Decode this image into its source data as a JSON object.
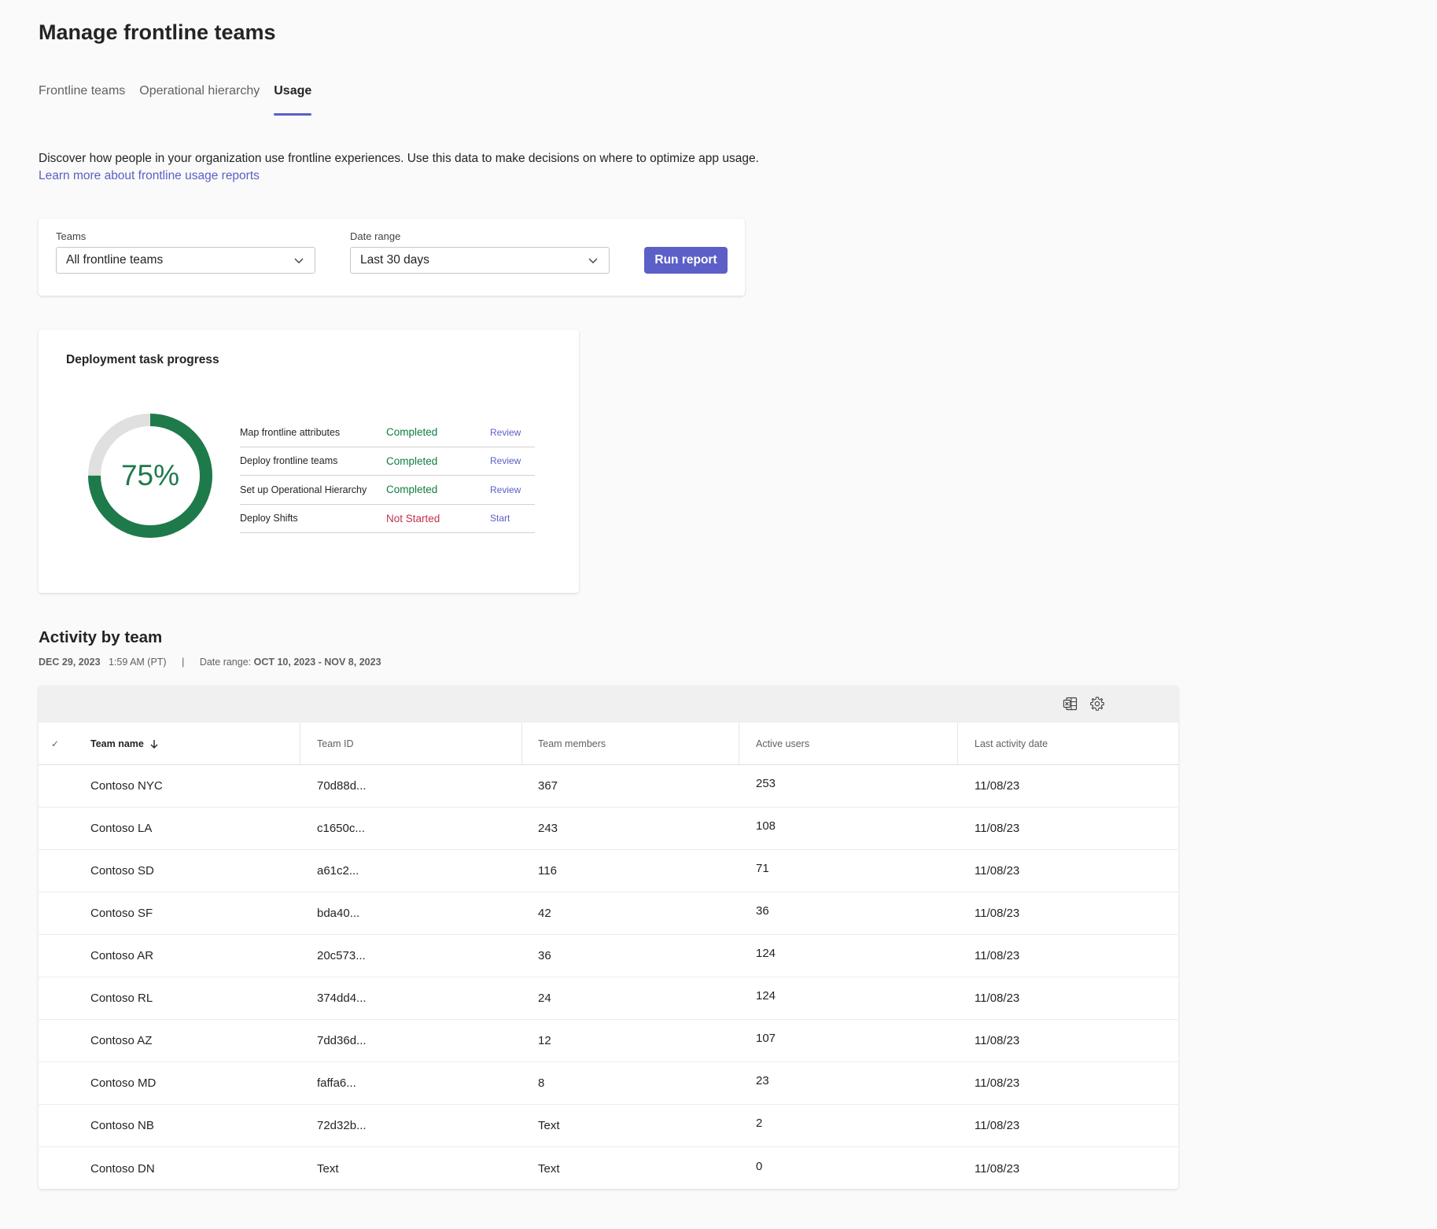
{
  "page_title": "Manage frontline teams",
  "tabs": [
    {
      "label": "Frontline teams",
      "active": false
    },
    {
      "label": "Operational hierarchy",
      "active": false
    },
    {
      "label": "Usage",
      "active": true
    }
  ],
  "description": "Discover how people in your organization use frontline experiences. Use this data to make decisions on where to optimize app usage.",
  "learn_more": "Learn more about frontline usage reports",
  "filters": {
    "teams_label": "Teams",
    "teams_value": "All frontline teams",
    "date_label": "Date range",
    "date_value": "Last 30 days",
    "run_label": "Run report"
  },
  "deployment": {
    "title": "Deployment task progress",
    "percent_label": "75%",
    "percent": 0.75,
    "tasks": [
      {
        "name": "Map frontline attributes",
        "status": "Completed",
        "action": "Review"
      },
      {
        "name": "Deploy frontline teams",
        "status": "Completed",
        "action": "Review"
      },
      {
        "name": "Set up Operational Hierarchy",
        "status": "Completed",
        "action": "Review"
      },
      {
        "name": "Deploy Shifts",
        "status": "Not Started",
        "action": "Start"
      }
    ]
  },
  "activity": {
    "title": "Activity by team",
    "date": "DEC 29, 2023",
    "time": "1:59 AM (PT)",
    "separator": "|",
    "range_label": "Date range:",
    "range_value": "OCT 10, 2023 - NOV 8, 2023",
    "check_mark": "✓",
    "columns": [
      "Team name",
      "Team ID",
      "Team members",
      "Active users",
      "Last activity date"
    ],
    "rows": [
      [
        "Contoso NYC",
        "70d88d...",
        "367",
        "253",
        "11/08/23"
      ],
      [
        "Contoso LA",
        "c1650c...",
        "243",
        "108",
        "11/08/23"
      ],
      [
        "Contoso SD",
        "a61c2...",
        "116",
        "71",
        "11/08/23"
      ],
      [
        "Contoso SF",
        "bda40...",
        "42",
        "36",
        "11/08/23"
      ],
      [
        "Contoso AR",
        "20c573...",
        "36",
        "124",
        "11/08/23"
      ],
      [
        "Contoso RL",
        "374dd4...",
        "24",
        "124",
        "11/08/23"
      ],
      [
        "Contoso AZ",
        "7dd36d...",
        "12",
        "107",
        "11/08/23"
      ],
      [
        "Contoso MD",
        "faffa6...",
        "8",
        "23",
        "11/08/23"
      ],
      [
        "Contoso NB",
        "72d32b...",
        "Text",
        "2",
        "11/08/23"
      ],
      [
        "Contoso DN",
        "Text",
        "Text",
        "0",
        "11/08/23"
      ]
    ]
  },
  "colors": {
    "accent": "#5b5fc7",
    "success": "#107c41",
    "donut": "#1e7a4a",
    "danger": "#c4314b"
  }
}
